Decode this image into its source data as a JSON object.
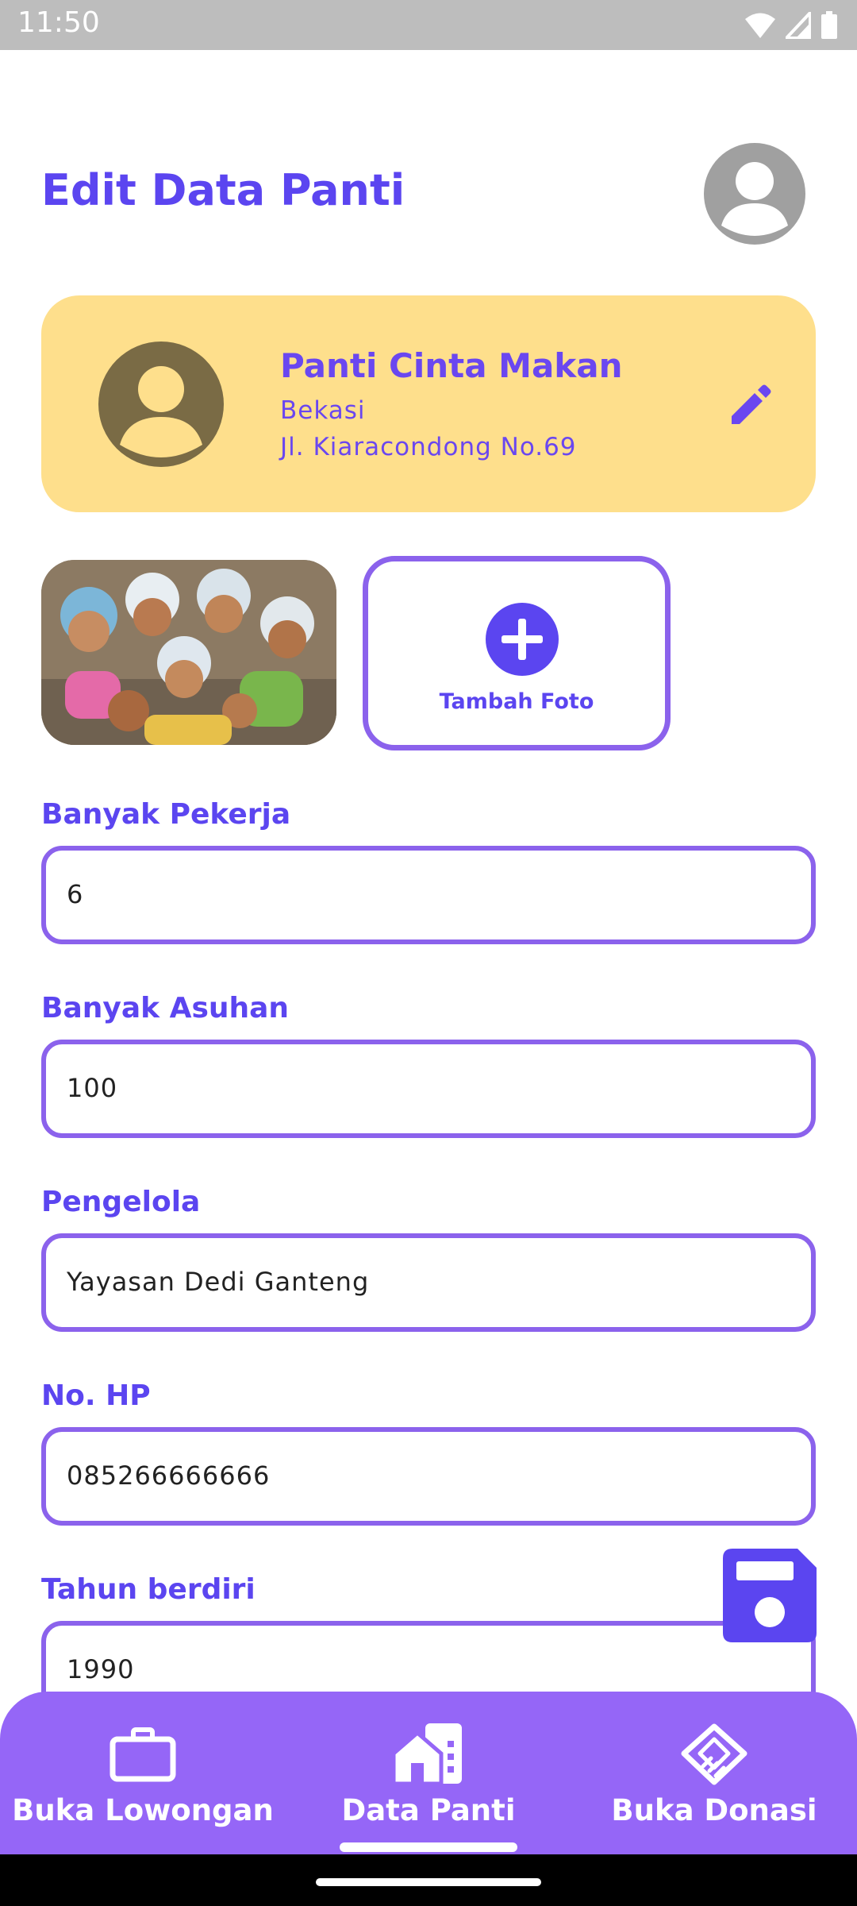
{
  "status_bar": {
    "time": "11:50",
    "icons": [
      "wifi-icon",
      "signal-icon",
      "battery-icon"
    ]
  },
  "header": {
    "title": "Edit Data Panti"
  },
  "profile": {
    "name": "Panti Cinta Makan",
    "city": "Bekasi",
    "address": "Jl. Kiaracondong No.69"
  },
  "photos": {
    "add_label": "Tambah Foto"
  },
  "fields": [
    {
      "label": "Banyak Pekerja",
      "value": "6"
    },
    {
      "label": "Banyak Asuhan",
      "value": "100"
    },
    {
      "label": "Pengelola",
      "value": "Yayasan Dedi Ganteng"
    },
    {
      "label": "No. HP",
      "value": "085266666666"
    },
    {
      "label": "Tahun berdiri",
      "value": "1990"
    }
  ],
  "bottom_nav": {
    "items": [
      {
        "label": "Buka Lowongan",
        "icon": "briefcase-icon",
        "active": false
      },
      {
        "label": "Data Panti",
        "icon": "house-building-icon",
        "active": true
      },
      {
        "label": "Buka Donasi",
        "icon": "handshake-icon",
        "active": false
      }
    ]
  },
  "colors": {
    "accent": "#5b45f0",
    "border": "#8b62ec",
    "card": "#fedf8c",
    "nav": "#9566f7"
  }
}
